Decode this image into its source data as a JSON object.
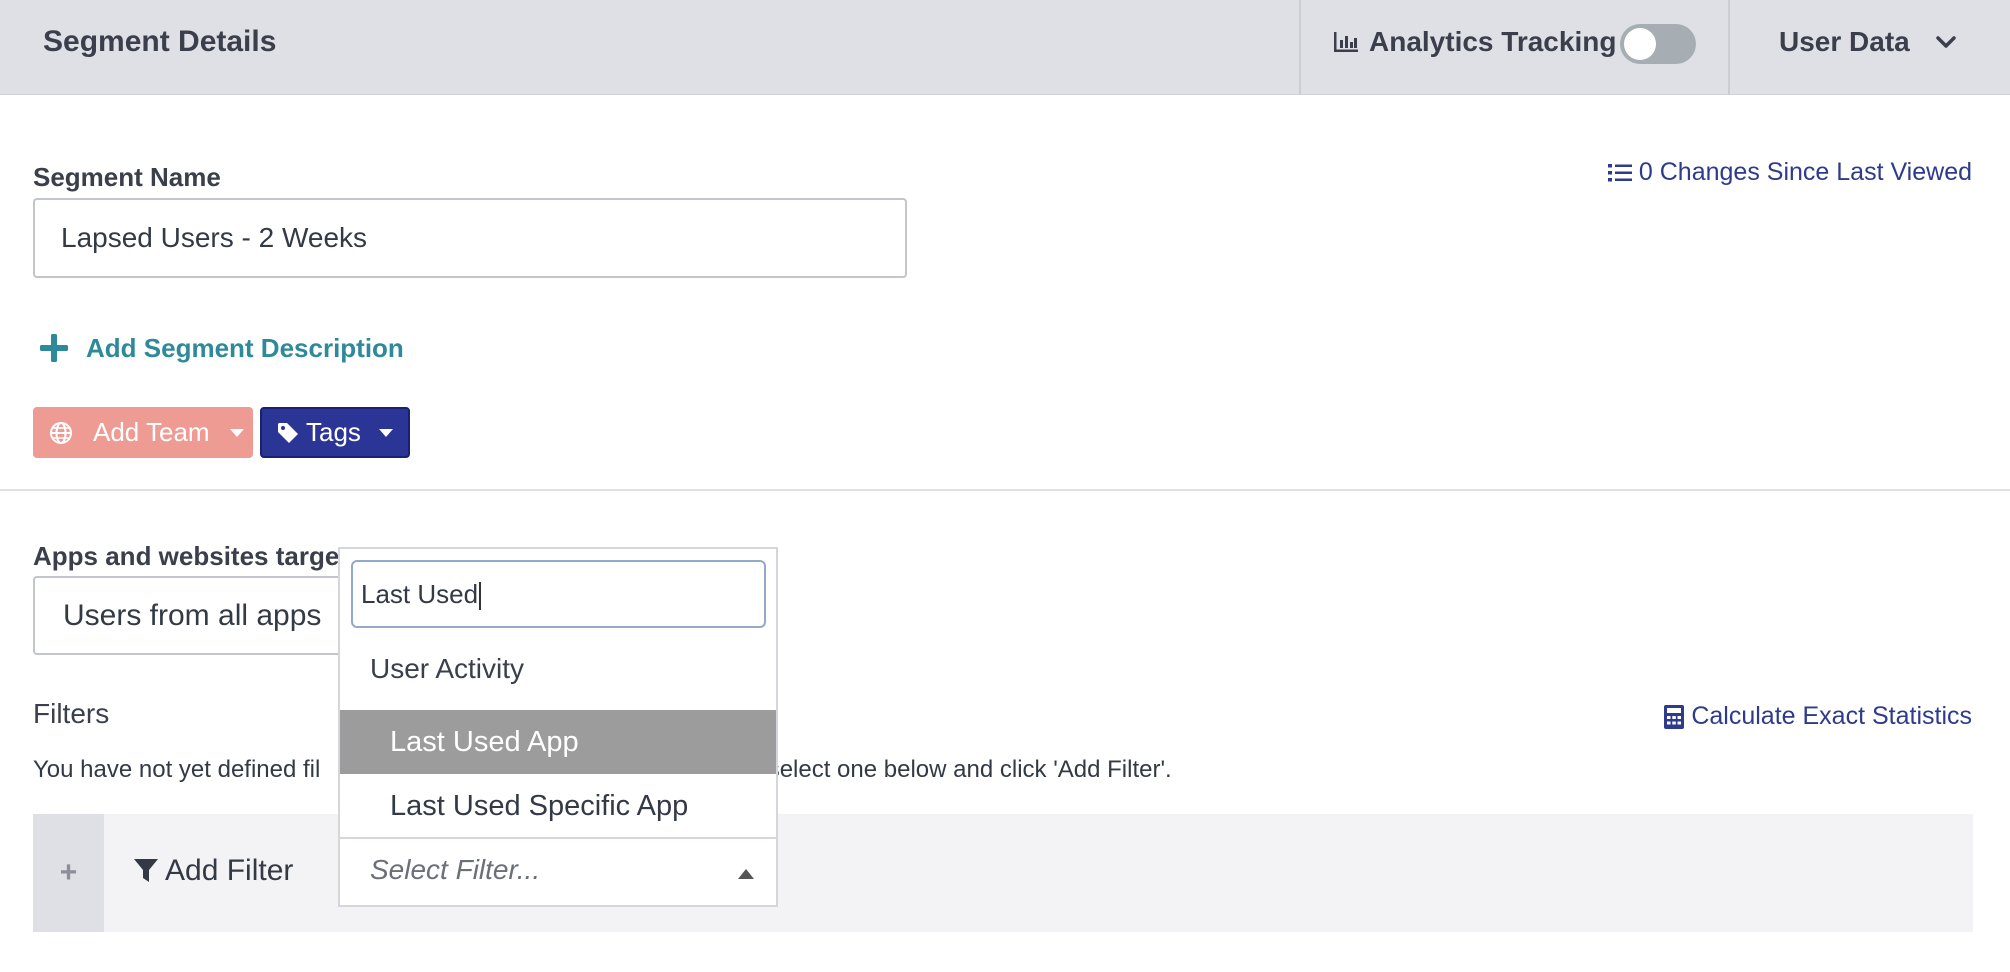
{
  "header": {
    "title": "Segment Details",
    "analytics_label": "Analytics Tracking",
    "analytics_enabled": false,
    "user_data_label": "User Data"
  },
  "segment": {
    "name_label": "Segment Name",
    "name_value": "Lapsed Users - 2 Weeks",
    "changes_link": "0 Changes Since Last Viewed",
    "add_description": "Add Segment Description"
  },
  "buttons": {
    "add_team": "Add Team",
    "tags": "Tags"
  },
  "apps": {
    "label": "Apps and websites targete",
    "value": "Users from all apps"
  },
  "filters": {
    "label": "Filters",
    "calc_link": "Calculate Exact Statistics",
    "note_left": "You have not yet defined fil",
    "note_right": "er, select one below and click 'Add Filter'.",
    "add_filter": "Add Filter"
  },
  "dropdown": {
    "search_value": "Last Used",
    "group_label": "User Activity",
    "options": [
      "Last Used App",
      "Last Used Specific App"
    ],
    "active_index": 0,
    "placeholder": "Select Filter..."
  },
  "colors": {
    "header_bg": "#dfe0e6",
    "link_blue": "#2e3a8c",
    "teal": "#2e8a9a",
    "team_btn": "#ee9b94",
    "tags_btn": "#2b3596",
    "highlight": "#9c9c9d"
  }
}
